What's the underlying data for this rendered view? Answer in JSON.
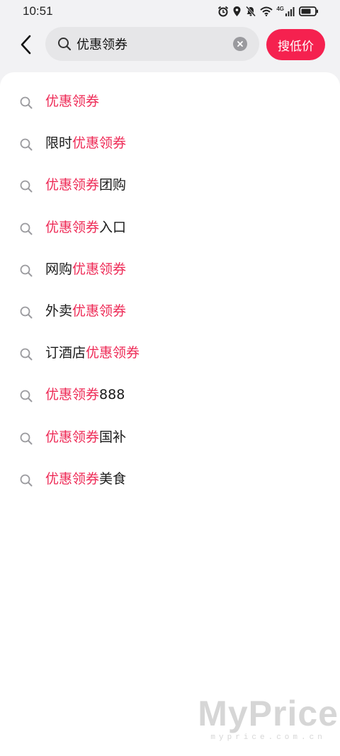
{
  "status_bar": {
    "time": "10:51",
    "network": "4G",
    "icons": [
      "alarm-icon",
      "location-icon",
      "mute-icon",
      "wifi-icon",
      "signal-icon",
      "battery-icon"
    ]
  },
  "search": {
    "query": "优惠领券",
    "button_label": "搜低价"
  },
  "suggestions": [
    {
      "parts": [
        {
          "text": "优惠领券",
          "hl": true
        }
      ]
    },
    {
      "parts": [
        {
          "text": "限时",
          "hl": false
        },
        {
          "text": "优惠领券",
          "hl": true
        }
      ]
    },
    {
      "parts": [
        {
          "text": "优惠领券",
          "hl": true
        },
        {
          "text": "团购",
          "hl": false
        }
      ]
    },
    {
      "parts": [
        {
          "text": "优惠领券",
          "hl": true
        },
        {
          "text": "入口",
          "hl": false
        }
      ]
    },
    {
      "parts": [
        {
          "text": "网购",
          "hl": false
        },
        {
          "text": "优惠领券",
          "hl": true
        }
      ]
    },
    {
      "parts": [
        {
          "text": "外卖",
          "hl": false
        },
        {
          "text": "优惠领券",
          "hl": true
        }
      ]
    },
    {
      "parts": [
        {
          "text": "订酒店",
          "hl": false
        },
        {
          "text": "优惠领券",
          "hl": true
        }
      ]
    },
    {
      "parts": [
        {
          "text": "优惠领券",
          "hl": true
        },
        {
          "text": "888",
          "hl": false
        }
      ]
    },
    {
      "parts": [
        {
          "text": "优惠领券",
          "hl": true
        },
        {
          "text": "国补",
          "hl": false
        }
      ]
    },
    {
      "parts": [
        {
          "text": "优惠领券",
          "hl": true
        },
        {
          "text": "美食",
          "hl": false
        }
      ]
    }
  ],
  "colors": {
    "accent": "#f5214f",
    "highlight_text": "#ee2a56",
    "background": "#f2f2f4"
  },
  "watermark": {
    "logo": "MyPrice",
    "url": "myprice.com.cn"
  }
}
